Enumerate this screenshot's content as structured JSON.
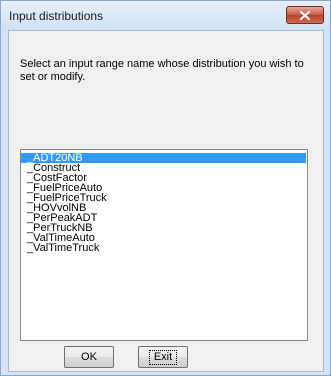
{
  "window": {
    "title": "Input distributions",
    "close_icon": "close-icon"
  },
  "dialog": {
    "prompt": "Select an input range name whose distribution you wish to set or modify.",
    "list": {
      "selected_index": 0,
      "items": [
        "_ADT20NB",
        "_Construct",
        "_CostFactor",
        "_FuelPriceAuto",
        "_FuelPriceTruck",
        "_HOVvolNB",
        "_PerPeakADT",
        "_PerTruckNB",
        "_ValTimeAuto",
        "_ValTimeTruck"
      ]
    },
    "buttons": {
      "ok_label": "OK",
      "exit_label": "Exit"
    }
  },
  "colors": {
    "selection": "#3399ff",
    "close_button": "#c75a45"
  }
}
